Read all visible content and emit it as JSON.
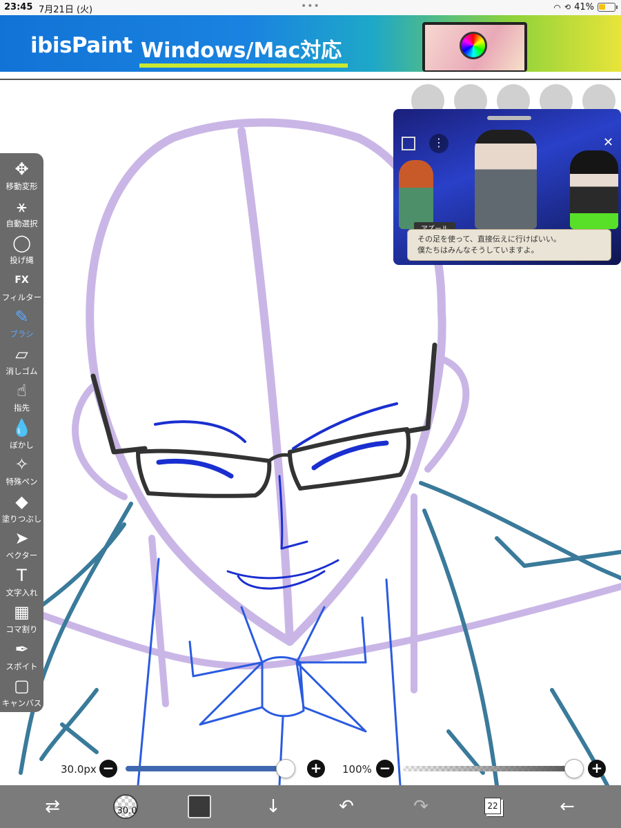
{
  "status": {
    "time": "23:45",
    "date": "7月21日 (火)",
    "dots": "•••",
    "battery_text": "41%",
    "battery_level": 0.41
  },
  "banner": {
    "logo": "ibisPaint",
    "text": "Windows/Mac対応"
  },
  "tools": [
    {
      "label": "移動変形",
      "icon": "move-icon"
    },
    {
      "label": "自動選択",
      "icon": "magic-wand-icon"
    },
    {
      "label": "投げ縄",
      "icon": "lasso-icon"
    },
    {
      "label": "フィルター",
      "icon": "fx-icon"
    },
    {
      "label": "ブラシ",
      "icon": "brush-icon"
    },
    {
      "label": "消しゴム",
      "icon": "eraser-icon"
    },
    {
      "label": "指先",
      "icon": "finger-icon"
    },
    {
      "label": "ぼかし",
      "icon": "blur-icon"
    },
    {
      "label": "特殊ペン",
      "icon": "special-pen-icon"
    },
    {
      "label": "塗りつぶし",
      "icon": "fill-icon"
    },
    {
      "label": "ベクター",
      "icon": "vector-icon"
    },
    {
      "label": "文字入れ",
      "icon": "text-icon"
    },
    {
      "label": "コマ割り",
      "icon": "frame-divider-icon"
    },
    {
      "label": "スポイト",
      "icon": "eyedropper-icon"
    },
    {
      "label": "キャンバス",
      "icon": "canvas-icon"
    }
  ],
  "active_tool": "ブラシ",
  "video": {
    "speaker": "アズール",
    "line1": "その足を使って、直接伝えに行けばいい。",
    "line2": "僕たちはみんなそうしていますよ。"
  },
  "sliders": {
    "size_label": "30.0px",
    "size_fraction": 0.95,
    "opacity_label": "100%",
    "opacity_fraction": 1.0,
    "minus": "−",
    "plus": "+"
  },
  "bottom": {
    "brush_size": "30.0",
    "layer_count": "22",
    "color": "#3a3a3a"
  }
}
